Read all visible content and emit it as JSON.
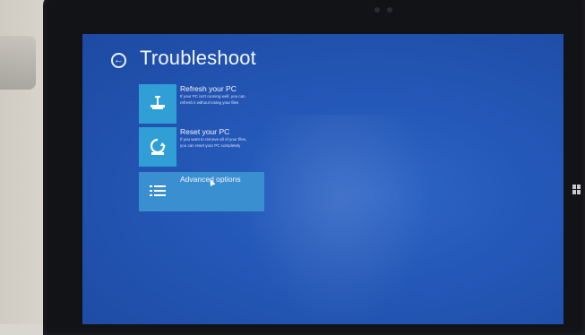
{
  "header": {
    "back_icon": "back-arrow-icon",
    "title": "Troubleshoot"
  },
  "options": [
    {
      "title": "Refresh your PC",
      "description_line1": "If your PC isn't running well, you can",
      "description_line2": "refresh it without losing your files",
      "icon": "refresh-pc-icon"
    },
    {
      "title": "Reset your PC",
      "description_line1": "If you want to remove all of your files,",
      "description_line2": "you can reset your PC completely",
      "icon": "reset-pc-icon"
    },
    {
      "title": "Advanced options",
      "icon": "advanced-options-icon"
    }
  ],
  "colors": {
    "screen_blue": "#2458b8",
    "tile_blue": "#2f9fd6",
    "selected_blue": "#3a8fd1"
  }
}
